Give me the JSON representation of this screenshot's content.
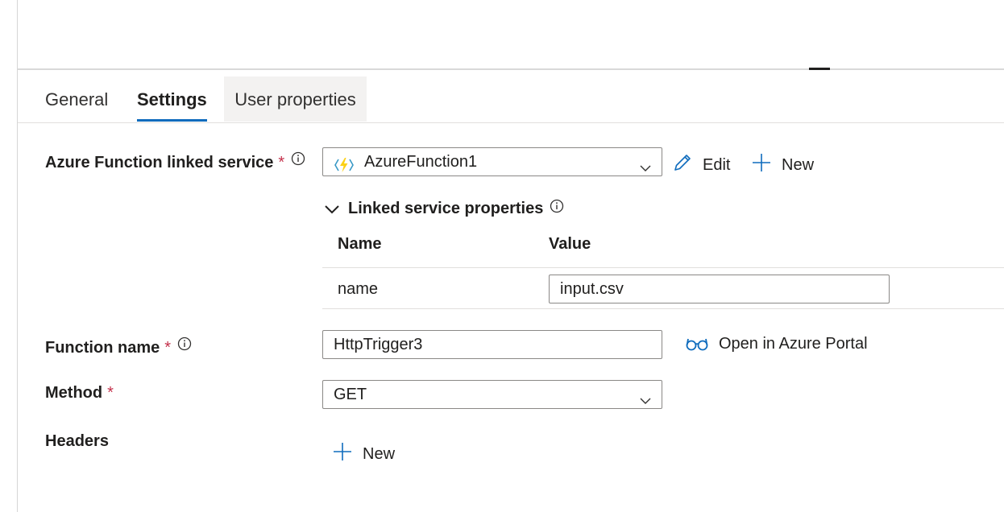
{
  "tabs": [
    {
      "label": "General"
    },
    {
      "label": "Settings"
    },
    {
      "label": "User properties"
    }
  ],
  "linked_service": {
    "label": "Azure Function linked service",
    "required_mark": "*",
    "value": "AzureFunction1",
    "edit_label": "Edit",
    "new_label": "New"
  },
  "linked_props": {
    "title": "Linked service properties",
    "columns": [
      "Name",
      "Value"
    ],
    "rows": [
      {
        "name": "name",
        "value": "input.csv"
      }
    ]
  },
  "function_name": {
    "label": "Function name",
    "required_mark": "*",
    "value": "HttpTrigger3",
    "open_portal_label": "Open in Azure Portal"
  },
  "method": {
    "label": "Method",
    "required_mark": "*",
    "value": "GET"
  },
  "headers": {
    "label": "Headers",
    "new_label": "New"
  },
  "colors": {
    "accent": "#0f6cbd",
    "required": "#c4314b"
  }
}
